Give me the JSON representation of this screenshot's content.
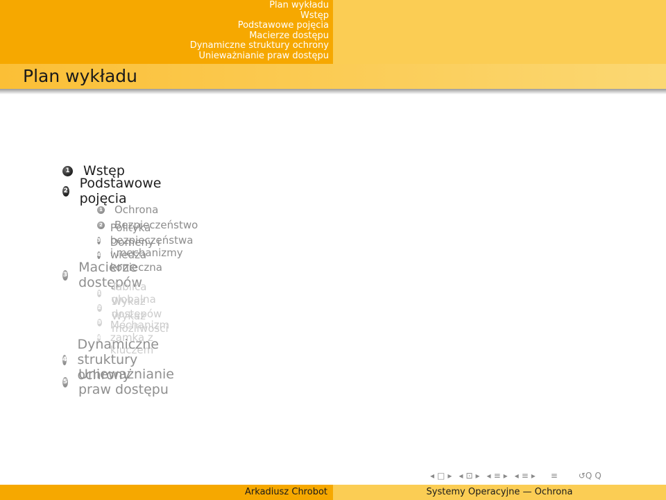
{
  "header_nav": {
    "items": [
      "Plan wykładu",
      "Wstęp",
      "Podstawowe pojęcia",
      "Macierze dostępu",
      "Dynamiczne struktury ochrony",
      "Unieważnianie praw dostępu"
    ]
  },
  "frame": {
    "title": "Plan wykładu"
  },
  "outline": {
    "sections": [
      {
        "number": "1",
        "label": "Wstęp"
      },
      {
        "number": "2",
        "label": "Podstawowe pojęcia"
      },
      {
        "number": "3",
        "label": "Macierze dostępów"
      },
      {
        "number": "4",
        "label": "Dynamiczne struktury ochrony"
      },
      {
        "number": "5",
        "label": "Unieważnianie praw dostępu"
      }
    ],
    "subsections_2": [
      {
        "number": "1",
        "label": "Ochrona"
      },
      {
        "number": "2",
        "label": "Bezpieczeństwo"
      },
      {
        "number": "3",
        "label": "Polityka bezpieczeństwa i mechanizmy"
      },
      {
        "number": "4",
        "label": "Domeny i wiedza konieczna"
      }
    ],
    "subsections_3": [
      {
        "number": "1",
        "label": "Tablica globalna"
      },
      {
        "number": "2",
        "label": "Wykaz dostępów"
      },
      {
        "number": "3",
        "label": "Wykaz możliwości"
      },
      {
        "number": "4",
        "label": "Mechanizm zamka z kluczem"
      }
    ]
  },
  "nav_symbols": {
    "frame_prev": "◂",
    "frame_icon": "□",
    "frame_next": "▸",
    "sub_prev": "◂",
    "sub_icon": "⊡",
    "sub_next": "▸",
    "sec_prev": "◂",
    "sec_icon": "≡",
    "sec_next": "▸",
    "subsec_prev": "◂",
    "subsec_icon": "≡",
    "subsec_next": "▸",
    "doc_icon": "≡",
    "search": "↺Q",
    "zoom": "Q"
  },
  "footer": {
    "author": "Arkadiusz Chrobot",
    "title": "Systemy Operacyjne — Ochrona"
  },
  "colors": {
    "header_left": "#f6a800",
    "header_right": "#fbcd54",
    "title_bar": "#fbbf36"
  }
}
